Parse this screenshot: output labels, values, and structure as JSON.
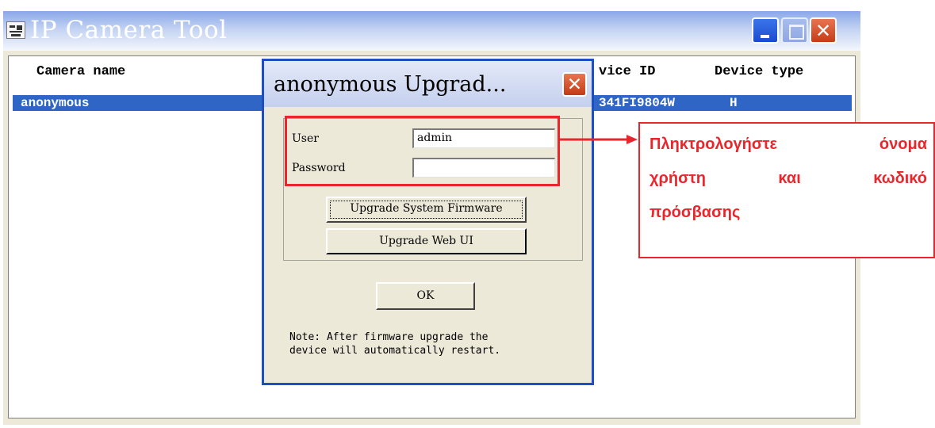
{
  "window": {
    "title": "IP Camera Tool",
    "icons": {
      "app": "camera-tool-icon",
      "minimize": "minimize-icon",
      "maximize": "maximize-icon",
      "close": "close-icon"
    }
  },
  "list": {
    "columns": [
      "Camera name",
      "vice ID",
      "Device type"
    ],
    "rows": [
      {
        "name": "anonymous",
        "device_id": "341FI9804W",
        "device_type": "H"
      }
    ]
  },
  "dialog": {
    "title": "anonymous Upgrad...",
    "user_label": "User",
    "user_value": "admin",
    "password_label": "Password",
    "password_value": "",
    "firmware_button": "Upgrade System Firmware",
    "webui_button": "Upgrade Web UI",
    "ok_button": "OK",
    "note": "Note: After firmware upgrade the\ndevice will automatically restart."
  },
  "annotation": {
    "line1_words": [
      "Πληκτρολογήστε",
      "όνομα"
    ],
    "line2_words": [
      "χρήστη",
      "και",
      "κωδικό"
    ],
    "line3": "πρόσβασης",
    "color": "#e8262c"
  },
  "colors": {
    "selection": "#2f66c6",
    "dialog_border": "#1e4fc2",
    "window_bg": "#ece9d8"
  }
}
